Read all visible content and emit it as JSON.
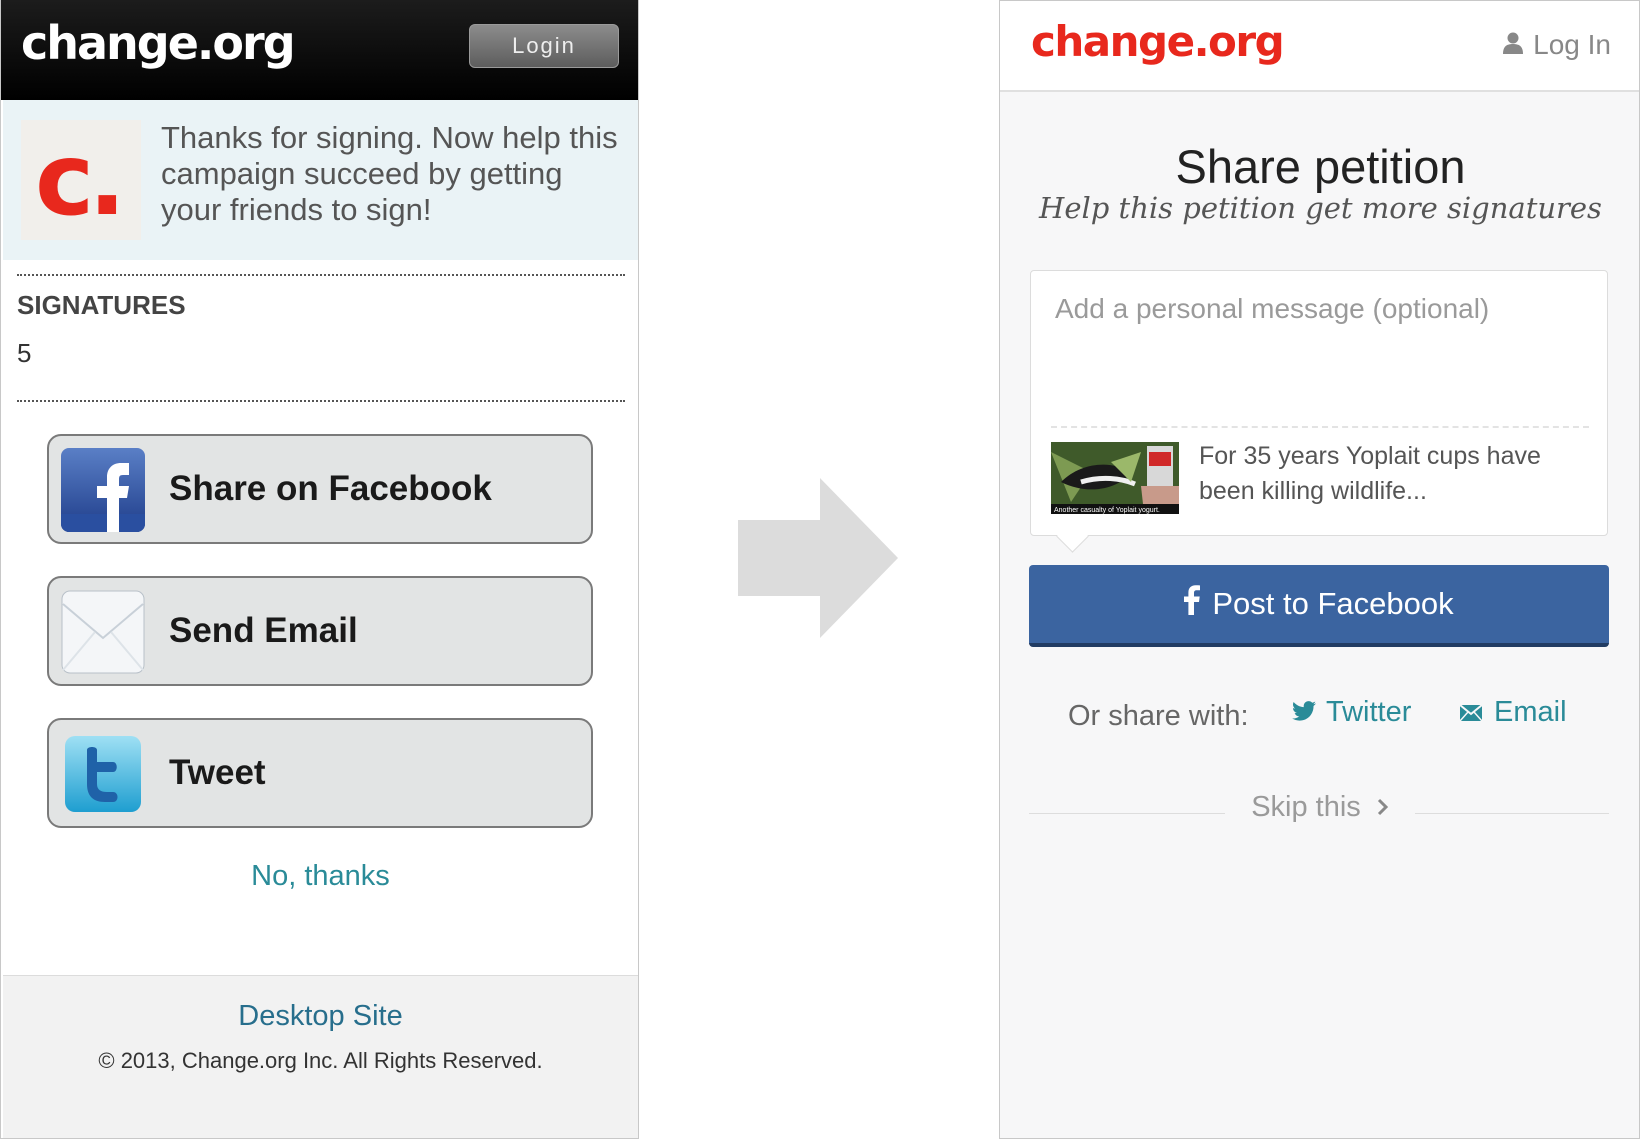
{
  "old_screen": {
    "logo": "change.org",
    "login_label": "Login",
    "thanks_message": "Thanks for signing. Now help this campaign succeed by getting your friends to sign!",
    "logo_badge_letter": "c.",
    "signatures_label": "SIGNATURES",
    "signatures_count": "5",
    "buttons": [
      {
        "label": "Share on Facebook",
        "icon": "facebook-icon"
      },
      {
        "label": "Send Email",
        "icon": "envelope-icon"
      },
      {
        "label": "Tweet",
        "icon": "twitter-icon"
      }
    ],
    "no_thanks": "No, thanks",
    "footer": {
      "desktop_site": "Desktop Site",
      "copyright": "© 2013, Change.org Inc. All Rights Reserved."
    }
  },
  "arrow": {
    "icon": "right-arrow-icon"
  },
  "new_screen": {
    "logo": "change.org",
    "login_label": "Log In",
    "title": "Share petition",
    "subtitle": "Help this petition get more signatures",
    "message_placeholder": "Add a personal message (optional)",
    "preview": {
      "thumbnail_caption": "Another casualty of Yoplait yogurt.",
      "text": "For 35 years Yoplait cups have been killing wildlife..."
    },
    "post_button": "Post to Facebook",
    "or_share_label": "Or share with:",
    "twitter_label": "Twitter",
    "email_label": "Email",
    "skip_label": "Skip this"
  },
  "colors": {
    "brand_red": "#e8281d",
    "facebook_blue": "#3b64a0",
    "link_teal": "#2a8b98"
  }
}
